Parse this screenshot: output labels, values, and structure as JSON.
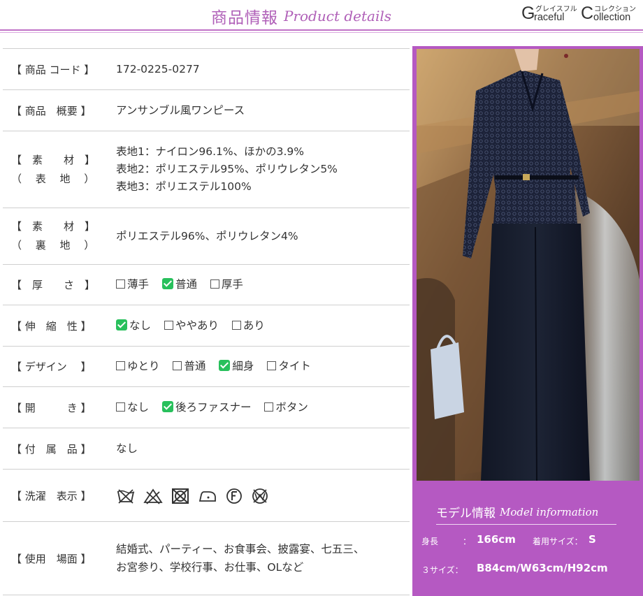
{
  "header": {
    "title_jp": "商品情報",
    "title_en": "Product details",
    "brand": {
      "big_g": "G",
      "small_left": "グレイスフル",
      "word_left": "raceful",
      "big_c": "C",
      "small_right": "コレクション",
      "word_right": "ollection"
    }
  },
  "rows": {
    "code": {
      "label": "【 商品 コード 】",
      "value": "172-0225-0277"
    },
    "summary": {
      "label": "【 商品　概要 】",
      "value": "アンサンブル風ワンピース"
    },
    "material_outer": {
      "label1": "【　素　　材　】",
      "label2": "（　 表　 地 　）",
      "lines": [
        "表地1：ナイロン96.1%、ほかの3.9%",
        "表地2：ポリエステル95%、ポリウレタン5%",
        "表地3：ポリエステル100%"
      ]
    },
    "material_lining": {
      "label1": "【　素　　材　】",
      "label2": "（　 裏　 地 　）",
      "value": "ポリエステル96%、ポリウレタン4%"
    },
    "thickness": {
      "label": "【　厚　　さ　】",
      "options": [
        {
          "text": "薄手",
          "checked": false
        },
        {
          "text": "普通",
          "checked": true
        },
        {
          "text": "厚手",
          "checked": false
        }
      ]
    },
    "stretch": {
      "label": "【 伸　縮　性 】",
      "options": [
        {
          "text": "なし",
          "checked": true
        },
        {
          "text": "ややあり",
          "checked": false
        },
        {
          "text": "あり",
          "checked": false
        }
      ]
    },
    "design": {
      "label": "【 デザイン　 】",
      "options": [
        {
          "text": "ゆとり",
          "checked": false
        },
        {
          "text": "普通",
          "checked": false
        },
        {
          "text": "細身",
          "checked": true
        },
        {
          "text": "タイト",
          "checked": false
        }
      ]
    },
    "opening": {
      "label": "【 開　　　き 】",
      "options": [
        {
          "text": "なし",
          "checked": false
        },
        {
          "text": "後ろファスナー",
          "checked": true
        },
        {
          "text": "ボタン",
          "checked": false
        }
      ]
    },
    "accessories": {
      "label": "【 付　属　品 】",
      "value": "なし"
    },
    "washing": {
      "label": "【 洗濯　表示 】",
      "icons": [
        "no-wash-icon",
        "no-bleach-icon",
        "no-tumble-dry-icon",
        "low-iron-icon",
        "dry-clean-f-icon",
        "no-wet-clean-icon"
      ]
    },
    "usage": {
      "label": "【 使用　場面 】",
      "lines": [
        "結婚式、パーティー、お食事会、披露宴、七五三、",
        "お宮参り、学校行事、お仕事、OLなど"
      ]
    }
  },
  "model": {
    "title_jp": "モデル情報",
    "title_en": "Model information",
    "height_label": "身長",
    "height_colon": "：",
    "height_value": "166cm",
    "size_label": "着用サイズ：",
    "size_value": "S",
    "measure_label": "３サイズ：",
    "measure_value": "B84cm/W63cm/H92cm"
  },
  "colors": {
    "accent": "#b559c2",
    "title": "#b060b8",
    "check": "#28c05c"
  }
}
